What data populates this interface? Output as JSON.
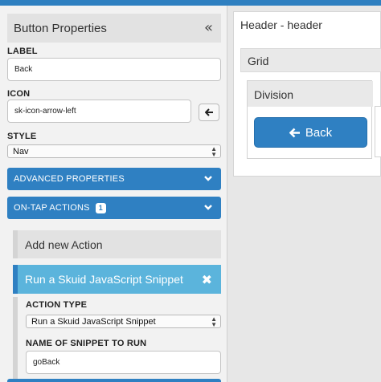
{
  "panel": {
    "title": "Button Properties",
    "collapse_icon": "«",
    "label_field": {
      "label": "LABEL",
      "value": "Back"
    },
    "icon_field": {
      "label": "ICON",
      "value": "sk-icon-arrow-left",
      "preview_glyph": "◆"
    },
    "style_field": {
      "label": "STYLE",
      "value": "Nav"
    },
    "advanced": {
      "label": "ADVANCED PROPERTIES"
    },
    "ontap": {
      "label": "ON-TAP ACTIONS",
      "count": "1"
    },
    "add_action": "Add new Action",
    "action": {
      "title": "Run a Skuid JavaScript Snippet",
      "action_type_label": "ACTION TYPE",
      "action_type_value": "Run a Skuid JavaScript Snippet",
      "snippet_label": "NAME OF SNIPPET TO RUN",
      "snippet_value": "goBack"
    }
  },
  "canvas": {
    "header_title": "Header - header",
    "grid_title": "Grid",
    "division_title": "Division",
    "button_label": "Back"
  },
  "colors": {
    "accent": "#2f80c2",
    "action_highlight": "#5bb4dc",
    "topbar": "#2e7fc0"
  }
}
